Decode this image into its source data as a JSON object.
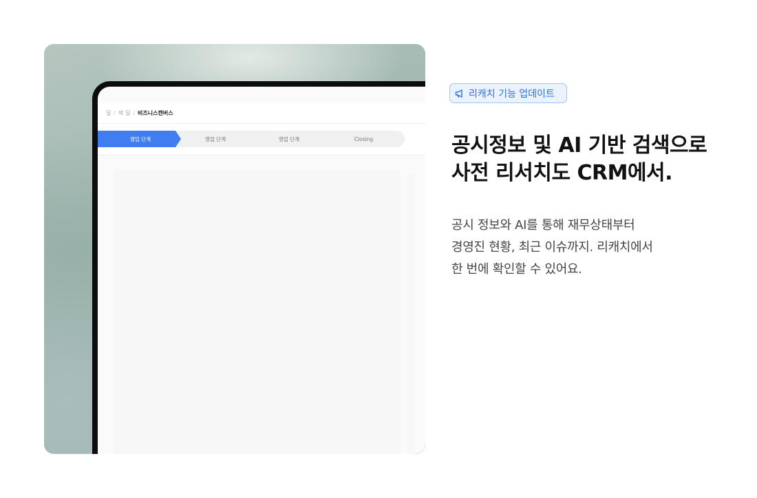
{
  "breadcrumb": {
    "items": [
      "딜",
      "박 딜",
      "비즈니스캔버스"
    ],
    "separator": "/"
  },
  "pipeline": {
    "steps": [
      {
        "label": "영업 단계",
        "active": true
      },
      {
        "label": "영업 단계",
        "active": false
      },
      {
        "label": "영업 단계",
        "active": false
      },
      {
        "label": "Closing",
        "active": false
      }
    ],
    "active_color": "#3f7ef0",
    "inactive_color": "#f0f0f0"
  },
  "badge": {
    "icon": "megaphone-icon",
    "label": "리캐치 기능 업데이트"
  },
  "headline": {
    "line1": "공시정보 및 AI 기반 검색으로",
    "line2": "사전 리서치도 CRM에서."
  },
  "description": {
    "line1": "공시 정보와 AI를 통해 재무상태부터",
    "line2": "경영진 현황, 최근 이슈까지. 리캐치에서",
    "line3": "한 번에 확인할 수 있어요."
  }
}
